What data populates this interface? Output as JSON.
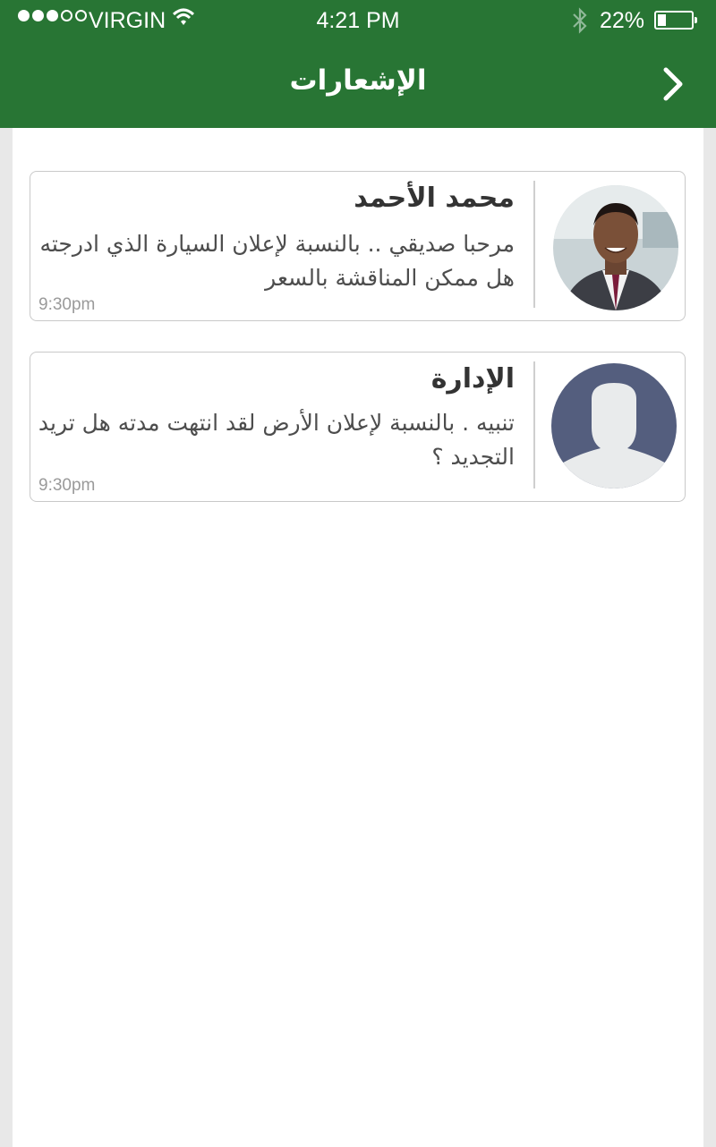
{
  "status_bar": {
    "carrier": "VIRGIN",
    "time": "4:21 PM",
    "battery": "22%",
    "signal_bars_filled": 3,
    "signal_bars_total": 5,
    "battery_level": 0.22
  },
  "header": {
    "title": "الإشعارات",
    "back_icon": "chevron-right-icon",
    "background": "#287534"
  },
  "notifications": [
    {
      "name": "محمد الأحمد",
      "message": "مرحبا صديقي .. بالنسبة لإعلان السيارة الذي ادرجته هل ممكن المناقشة بالسعر",
      "time": "9:30pm",
      "avatar": "user-photo"
    },
    {
      "name": "الإدارة",
      "message": "تنبيه . بالنسبة لإعلان الأرض لقد انتهت مدته هل تريد التجديد ؟",
      "time": "9:30pm",
      "avatar": "default-user-icon"
    }
  ]
}
